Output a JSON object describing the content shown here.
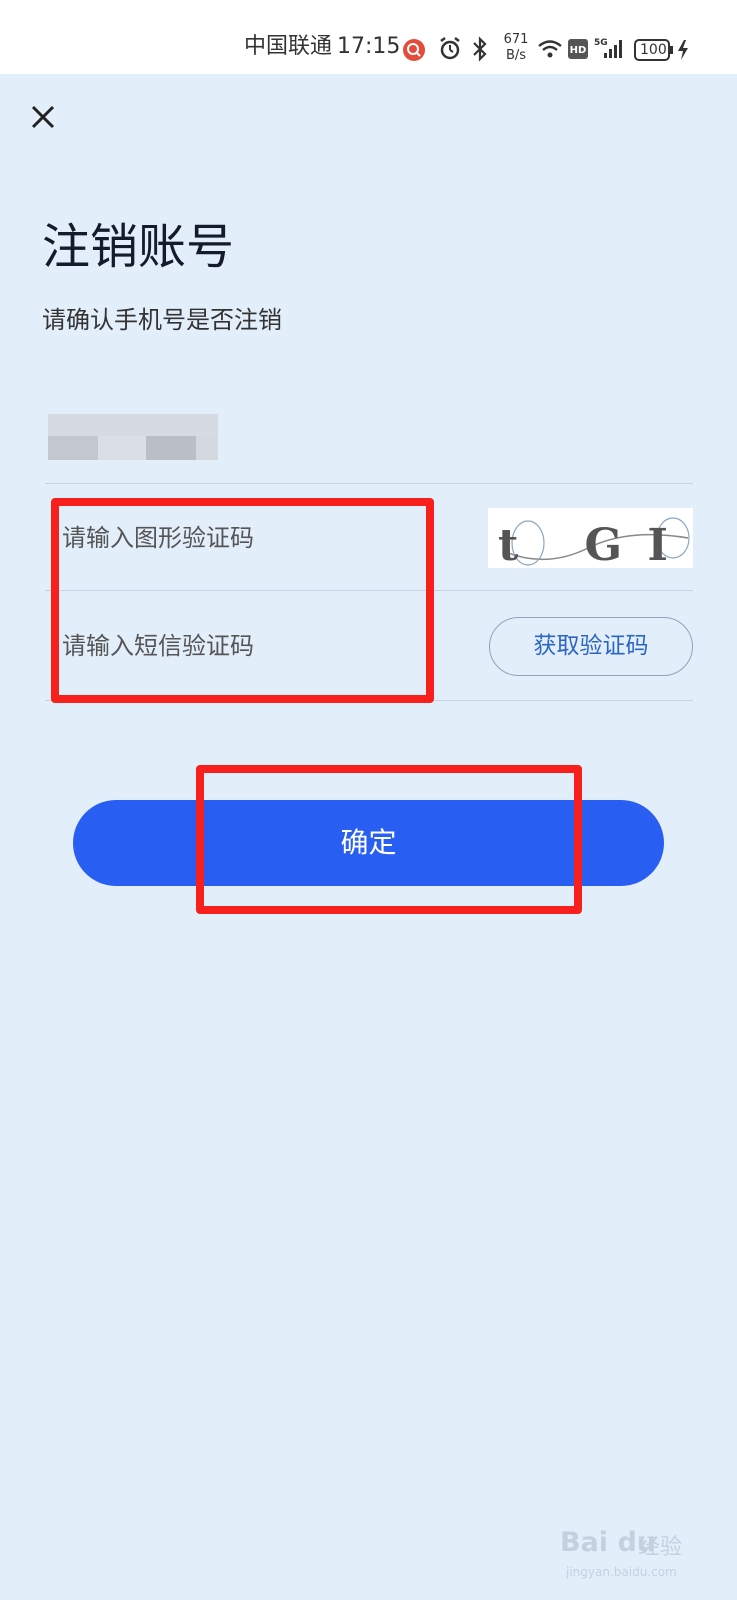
{
  "status_bar": {
    "carrier": "中国联通",
    "time": "17:15",
    "network_speed_value": "671",
    "network_speed_unit": "B/s",
    "hd_label": "HD",
    "signal_label": "5G",
    "battery": "100",
    "icons": [
      "search-badge-icon",
      "alarm-icon",
      "bluetooth-icon",
      "wifi-icon",
      "hd-icon",
      "signal-icon",
      "battery-icon",
      "charging-icon"
    ]
  },
  "page": {
    "title": "注销账号",
    "subtitle": "请确认手机号是否注销"
  },
  "form": {
    "captcha_placeholder": "请输入图形验证码",
    "sms_placeholder": "请输入短信验证码",
    "sms_button_label": "获取验证码",
    "captcha_text": "t GI",
    "confirm_label": "确定"
  },
  "colors": {
    "background": "#e3eefb",
    "primary": "#295ef2",
    "link": "#2b66c7",
    "highlight": "#f8201d"
  },
  "watermark": {
    "brand": "Bai du",
    "sub": "经验",
    "url": "jingyan.baidu.com"
  }
}
